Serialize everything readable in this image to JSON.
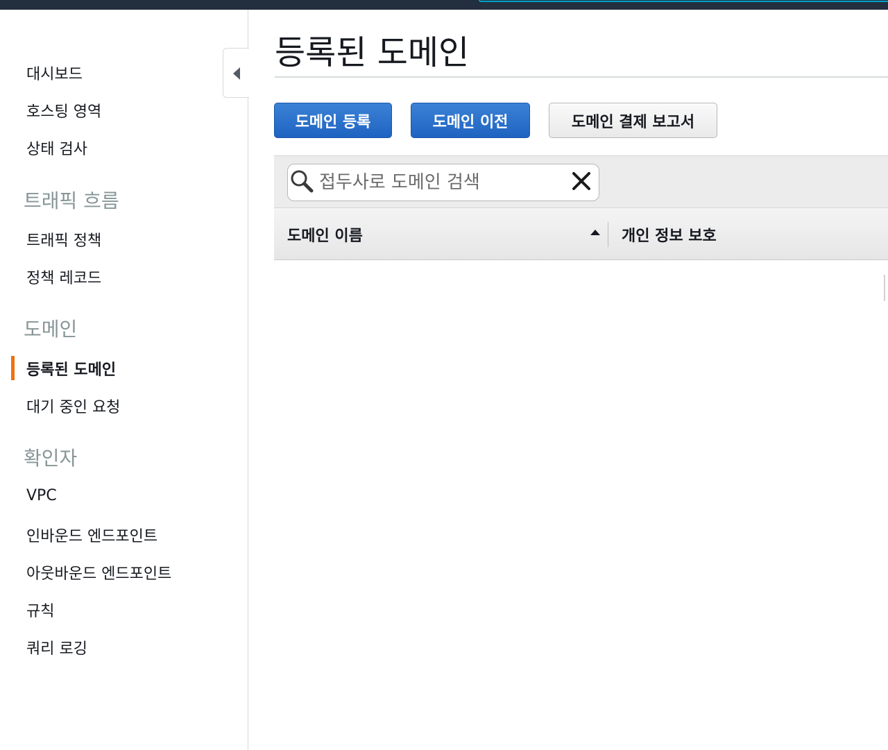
{
  "sidebar": {
    "items_top": [
      {
        "label": "대시보드"
      },
      {
        "label": "호스팅 영역"
      },
      {
        "label": "상태 검사"
      }
    ],
    "sections": [
      {
        "title": "트래픽 흐름",
        "items": [
          {
            "label": "트래픽 정책"
          },
          {
            "label": "정책 레코드"
          }
        ]
      },
      {
        "title": "도메인",
        "items": [
          {
            "label": "등록된 도메인",
            "active": true
          },
          {
            "label": "대기 중인 요청"
          }
        ]
      },
      {
        "title": "확인자",
        "items": [
          {
            "label": "VPC"
          },
          {
            "label": "인바운드 엔드포인트"
          },
          {
            "label": "아웃바운드 엔드포인트"
          },
          {
            "label": "규칙"
          },
          {
            "label": "쿼리 로깅"
          }
        ]
      }
    ],
    "accent_color": "#ec7211"
  },
  "main": {
    "title": "등록된 도메인",
    "buttons": {
      "register": "도메인 등록",
      "transfer": "도메인 이전",
      "billing_report": "도메인 결제 보고서"
    },
    "search": {
      "placeholder": "접두사로 도메인 검색",
      "value": ""
    },
    "table": {
      "columns": [
        {
          "label": "도메인 이름",
          "sort": "ascending"
        },
        {
          "label": "개인 정보 보호"
        }
      ],
      "rows": []
    }
  },
  "colors": {
    "primary_button": "#1f63c1",
    "topbar": "#232f3e",
    "section_title": "#879596"
  },
  "icons": [
    "collapse-sidebar-icon",
    "search-icon",
    "close-icon",
    "sort-ascending-icon"
  ]
}
